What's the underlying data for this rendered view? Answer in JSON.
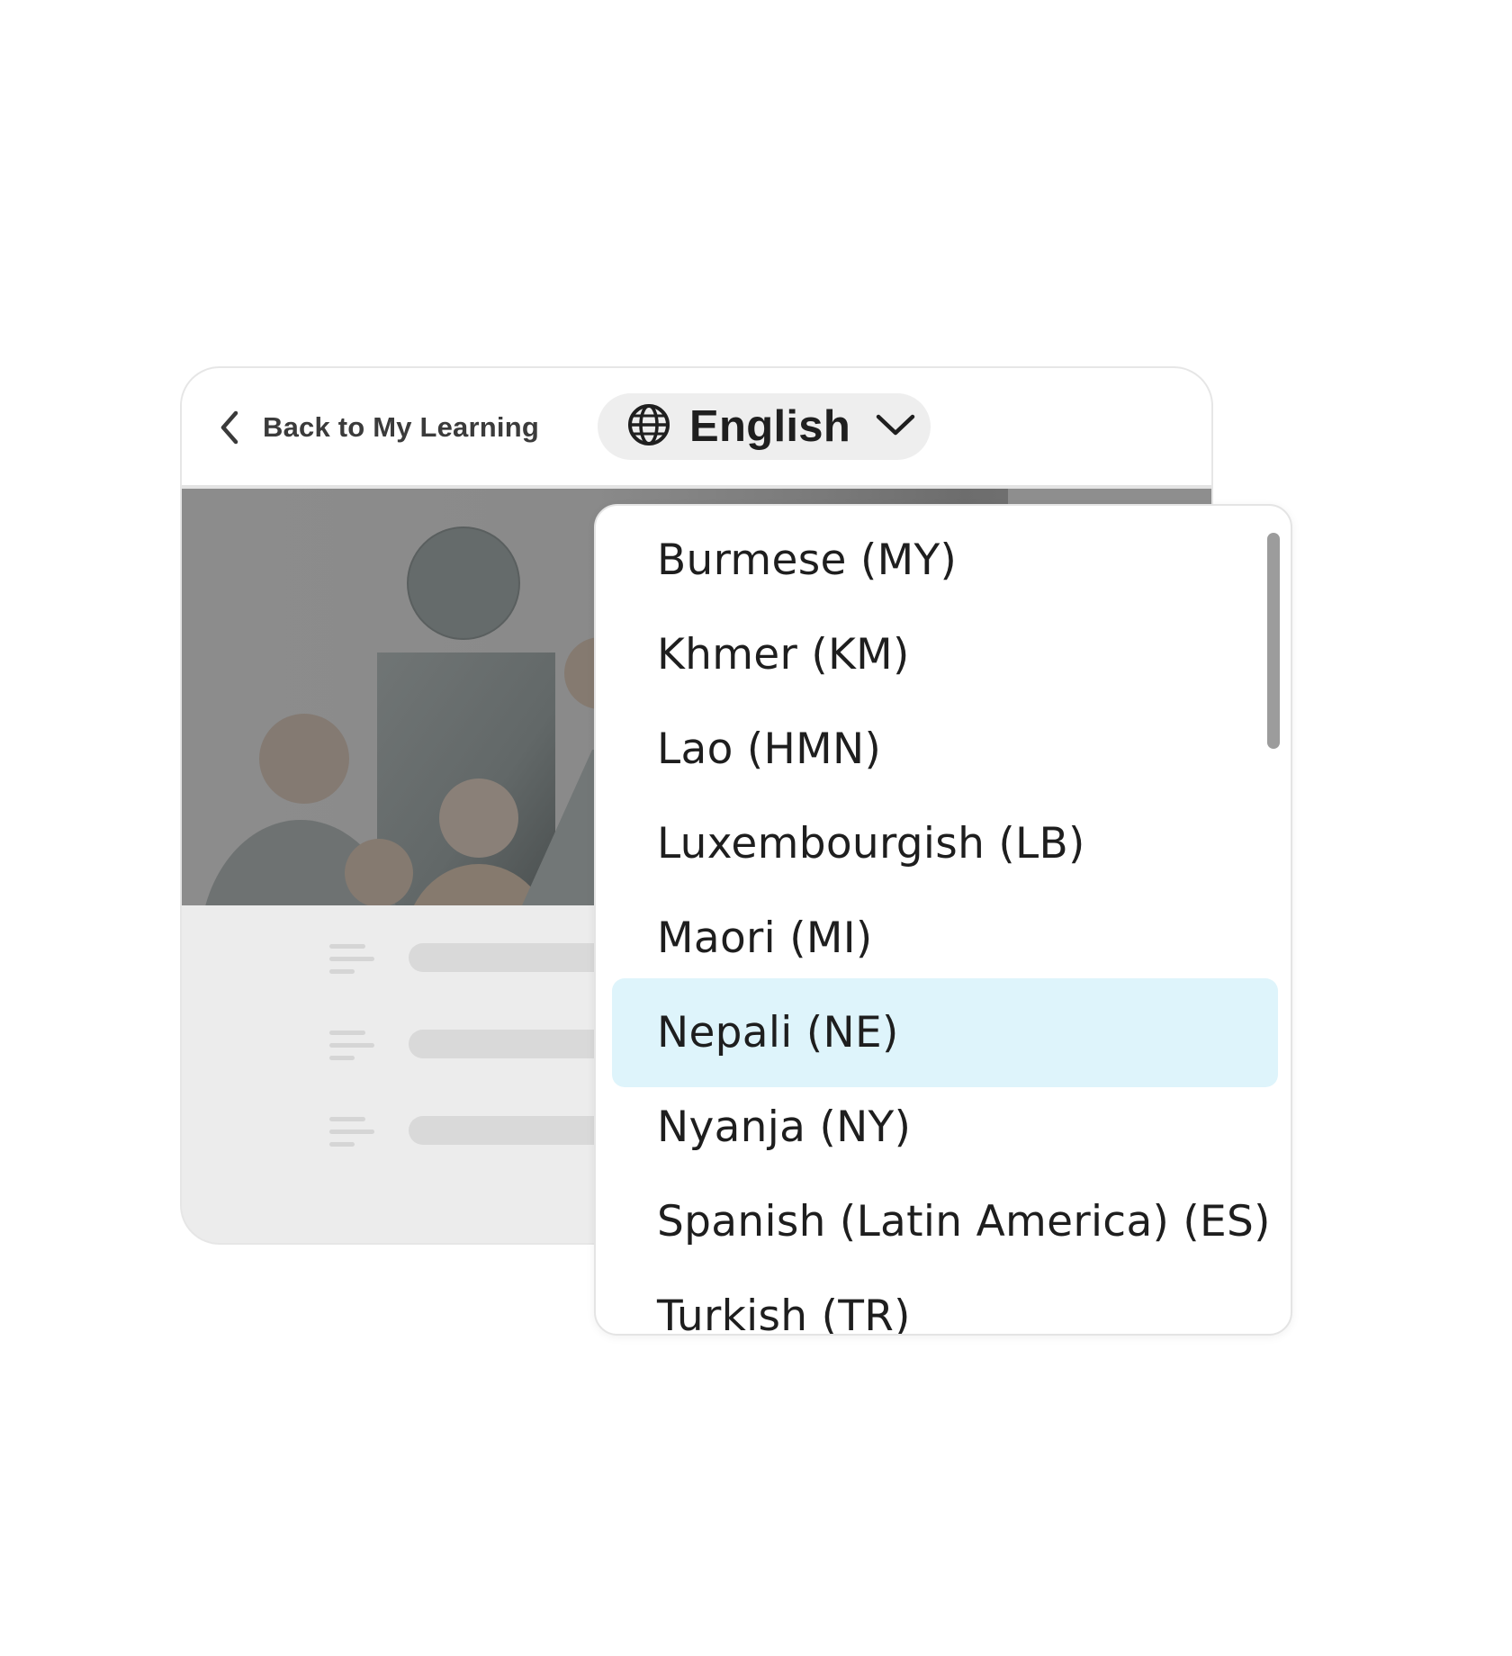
{
  "header": {
    "back_label": "Back to My Learning",
    "language_selector": {
      "current": "English"
    }
  },
  "language_dropdown": {
    "options": [
      {
        "label": "Burmese (MY)",
        "selected": false
      },
      {
        "label": "Khmer (KM)",
        "selected": false
      },
      {
        "label": "Lao (HMN)",
        "selected": false
      },
      {
        "label": "Luxembourgish (LB)",
        "selected": false
      },
      {
        "label": "Maori (MI)",
        "selected": false
      },
      {
        "label": "Nepali (NE)",
        "selected": true
      },
      {
        "label": "Nyanja (NY)",
        "selected": false
      },
      {
        "label": "Spanish (Latin America) (ES)",
        "selected": false
      },
      {
        "label": "Turkish (TR)",
        "selected": false
      }
    ],
    "selected_color": "#def4fb"
  },
  "icons": {
    "back": "chevron-left-icon",
    "language": "globe-icon",
    "dropdown": "chevron-down-icon",
    "list_rows": "text-lines-icon"
  },
  "colors": {
    "card_border": "#e6e6e6",
    "content_bg": "#ececec",
    "placeholder_bar": "#d9d9d9",
    "scrollbar": "#9c9c9c"
  }
}
